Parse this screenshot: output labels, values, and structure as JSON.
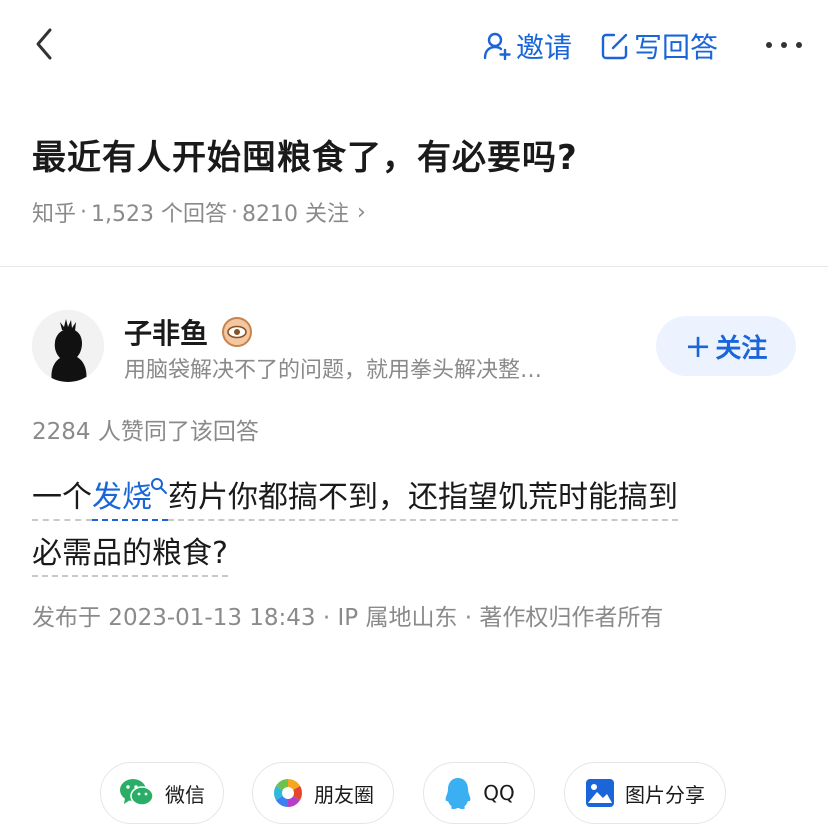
{
  "header": {
    "invite_label": "邀请",
    "write_label": "写回答"
  },
  "question": {
    "title": "最近有人开始囤粮食了，有必要吗?",
    "source": "知乎",
    "answer_count": "1,523 个回答",
    "follow_count": "8210 关注"
  },
  "author": {
    "name": "子非鱼",
    "bio": "用脑袋解决不了的问题，就用拳头解决整…",
    "follow_label": "关注"
  },
  "answer": {
    "upvotes": "2284 人赞同了该回答",
    "text_before": "一个",
    "keyword": "发烧",
    "text_after_line1": "药片你都搞不到，还指望饥荒时能搞到",
    "text_line2": "必需品的粮食?",
    "published": "发布于 2023-01-13 18:43 · IP 属地山东 · 著作权归作者所有"
  },
  "share": {
    "items": [
      {
        "label": "微信",
        "icon": "wechat-icon"
      },
      {
        "label": "朋友圈",
        "icon": "moments-icon"
      },
      {
        "label": "QQ",
        "icon": "qq-icon"
      },
      {
        "label": "图片分享",
        "icon": "image-share-icon"
      }
    ]
  },
  "colors": {
    "accent": "#1a66d8",
    "muted": "#8a8a8a",
    "follow_bg": "#ecf3ff"
  }
}
